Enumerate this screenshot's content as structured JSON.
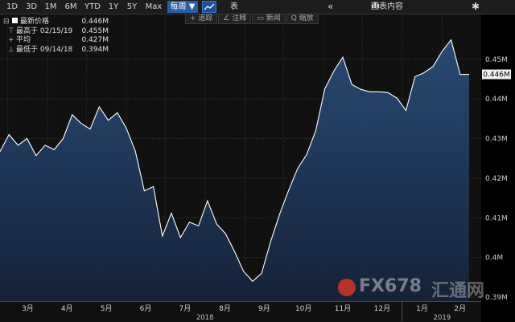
{
  "toolbar": {
    "periods": [
      "1D",
      "3D",
      "1M",
      "6M",
      "YTD",
      "1Y",
      "5Y",
      "Max"
    ],
    "frequency": "每周 ▼",
    "table_label": "表",
    "collapse_glyph": "«",
    "chart_content_label": "图表内容",
    "gear_glyph": "✱"
  },
  "subtools": {
    "track": "+ 追踪",
    "annotate": "∠ 注释",
    "news": "▭ 新闻",
    "zoom": "Q 缩放"
  },
  "legend": {
    "last_label": "最新价格",
    "last_value": "0.446M",
    "high_label": "最高于 02/15/19",
    "high_value": "0.455M",
    "avg_label": "平均",
    "avg_value": "0.427M",
    "low_label": "最低于 09/14/18",
    "low_value": "0.394M"
  },
  "watermark": {
    "text": "FX678",
    "cn": "汇通网"
  },
  "chart_data": {
    "type": "area",
    "ylim": [
      0.389,
      0.4615
    ],
    "y_ticks": [
      "0.39M",
      "0.4M",
      "0.41M",
      "0.42M",
      "0.43M",
      "0.44M",
      "0.45M"
    ],
    "y_tick_values": [
      0.39,
      0.4,
      0.41,
      0.42,
      0.43,
      0.44,
      0.45
    ],
    "last_value_label": "0.446M",
    "x_month_labels": [
      "3月",
      "4月",
      "5月",
      "6月",
      "7月",
      "8月",
      "9月",
      "10月",
      "11月",
      "12月",
      "1月",
      "2月"
    ],
    "x_year_labels": [
      "2018",
      "2019"
    ],
    "colors": {
      "line": "#ffffff",
      "fill_top": "#284a74",
      "fill_bottom": "#152238",
      "grid": "#3a3a3a",
      "bg_plot": "#111111"
    },
    "series": [
      {
        "x": [
          "2018-02-23",
          "2018-03-02",
          "2018-03-09",
          "2018-03-16",
          "2018-03-23",
          "2018-03-30",
          "2018-04-06",
          "2018-04-13",
          "2018-04-20",
          "2018-04-27",
          "2018-05-04",
          "2018-05-11",
          "2018-05-18",
          "2018-05-25",
          "2018-06-01",
          "2018-06-08",
          "2018-06-15",
          "2018-06-22",
          "2018-06-29",
          "2018-07-06",
          "2018-07-13",
          "2018-07-20",
          "2018-07-27",
          "2018-08-03",
          "2018-08-10",
          "2018-08-17",
          "2018-08-24",
          "2018-08-31",
          "2018-09-07",
          "2018-09-14",
          "2018-09-21",
          "2018-09-28",
          "2018-10-05",
          "2018-10-12",
          "2018-10-19",
          "2018-10-26",
          "2018-11-02",
          "2018-11-09",
          "2018-11-16",
          "2018-11-23",
          "2018-11-30",
          "2018-12-07",
          "2018-12-14",
          "2018-12-21",
          "2018-12-28",
          "2019-01-04",
          "2019-01-11",
          "2019-01-18",
          "2019-01-25",
          "2019-02-01",
          "2019-02-08",
          "2019-02-15",
          "2019-02-22"
        ],
        "values": [
          0.4267,
          0.431,
          0.4283,
          0.43,
          0.4257,
          0.4283,
          0.4272,
          0.43,
          0.436,
          0.4338,
          0.4324,
          0.438,
          0.4346,
          0.4365,
          0.4326,
          0.4268,
          0.4168,
          0.4179,
          0.4054,
          0.4112,
          0.405,
          0.4089,
          0.408,
          0.4143,
          0.4085,
          0.406,
          0.4015,
          0.3965,
          0.394,
          0.396,
          0.404,
          0.411,
          0.417,
          0.4225,
          0.426,
          0.432,
          0.4425,
          0.447,
          0.4505,
          0.4436,
          0.4424,
          0.4418,
          0.4418,
          0.4416,
          0.4402,
          0.4371,
          0.4456,
          0.4466,
          0.4482,
          0.452,
          0.4549,
          0.4462,
          0.4462
        ]
      }
    ]
  }
}
